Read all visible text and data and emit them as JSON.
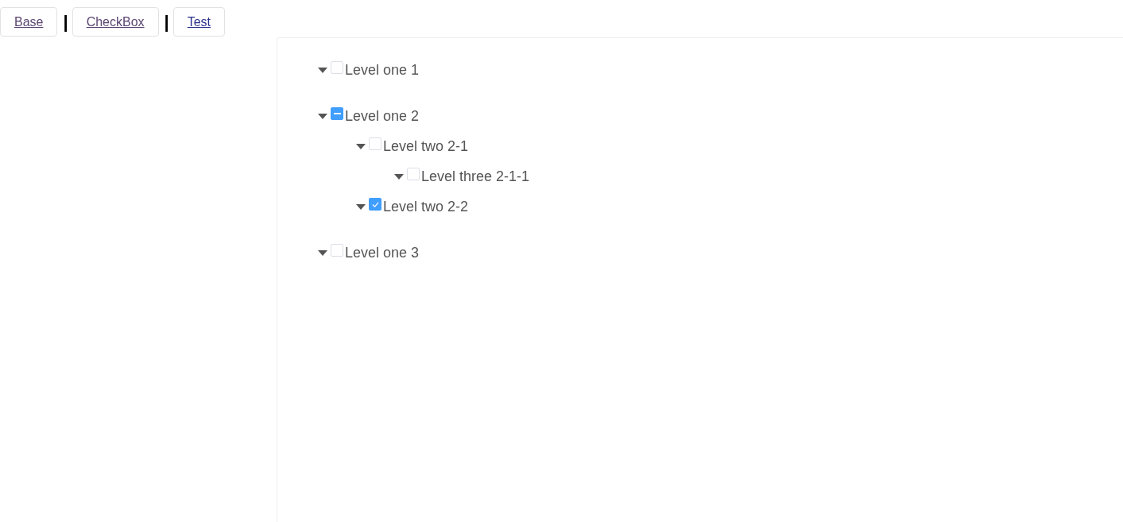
{
  "nav": [
    {
      "kind": "link",
      "label": "Base",
      "visited": true
    },
    {
      "kind": "separator",
      "label": "|"
    },
    {
      "kind": "link",
      "label": "CheckBox",
      "visited": true
    },
    {
      "kind": "separator",
      "label": "|"
    },
    {
      "kind": "link",
      "label": "Test",
      "visited": false
    }
  ],
  "tree": [
    {
      "label": "Level one 1",
      "expanded": true,
      "checked": false,
      "indeterminate": false
    },
    {
      "label": "Level one 2",
      "expanded": true,
      "checked": false,
      "indeterminate": true,
      "children": [
        {
          "label": "Level two 2-1",
          "expanded": true,
          "checked": false,
          "indeterminate": false,
          "children": [
            {
              "label": "Level three 2-1-1",
              "expanded": true,
              "checked": false,
              "indeterminate": false
            }
          ]
        },
        {
          "label": "Level two 2-2",
          "expanded": true,
          "checked": true,
          "indeterminate": false
        }
      ]
    },
    {
      "label": "Level one 3",
      "expanded": true,
      "checked": false,
      "indeterminate": false
    }
  ]
}
